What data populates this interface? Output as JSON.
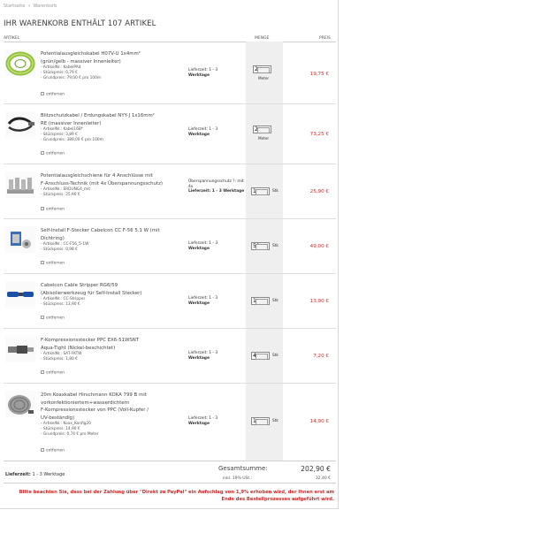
{
  "breadcrumb": {
    "home": "Startseite",
    "separator": "»",
    "current": "Warenkorb"
  },
  "page_title": "IHR WARENKORB ENTHÄLT 107 ARTIKEL",
  "columns": {
    "article": "ARTIKEL",
    "quantity": "MENGE",
    "price": "PREIS"
  },
  "remove_label": "entfernen",
  "items": [
    {
      "name_lines": [
        "Potentialausgleichskabel H07V-U 1x4mm²",
        "(grün/gelb - massiver Innenleiter)"
      ],
      "meta": [
        "- ArtikelNr.: KabelPA4",
        "- Stückpreis: 0,79 €",
        "- Grundpreis: 79,00 € pro 100m"
      ],
      "delivery_label": "Lieferzeit: 1 - 3",
      "delivery_sub": "Werktage",
      "qty": "2",
      "unit": "Meter",
      "price": "19,75 €",
      "thumb": "green-cable-coil"
    },
    {
      "name_lines": [
        "Blitzschutzkabel / Erdungskabel NYY-J 1x16mm²",
        "RE (massiver Innenleiter)"
      ],
      "meta": [
        "- ArtikelNr.: Kabel16B*",
        "- Stückpreis: 3,89 €",
        "- Grundpreis: 389,00 € pro 100m"
      ],
      "delivery_label": "Lieferzeit: 1 - 3",
      "delivery_sub": "Werktage",
      "qty": "2",
      "unit": "Meter",
      "price": "73,25 €",
      "thumb": "black-cable"
    },
    {
      "name_lines": [
        "Potentialausgleichschiene für 4 Anschlüsse mit",
        "F-Anschluss-Technik (mit 4x Überspannungsschutz)"
      ],
      "meta": [
        "- ArtikelNr.: ERDUNG4_mit",
        "- Stückpreis: 25,90 €"
      ],
      "delivery_label": "Überspannungsschutz ?: mit 4x",
      "delivery_sub": "Lieferzeit: 1 - 3 Werktage",
      "qty": "1",
      "unit": "Stk",
      "price": "25,90 €",
      "thumb": "grounding-bar"
    },
    {
      "name_lines": [
        "Self-Install F-Stecker Cabelcon CC F-56 5.1 W (mit",
        "Dichtring)"
      ],
      "meta": [
        "- ArtikelNr.: CC-F56_5-1W",
        "- Stückpreis: 0,98 €"
      ],
      "delivery_label": "Lieferzeit: 1 - 3",
      "delivery_sub": "Werktage",
      "qty": "50",
      "unit": "Stk",
      "price": "49,00 €",
      "thumb": "f-connector"
    },
    {
      "name_lines": [
        "Cabelcon Cable Stripper RG6/59",
        "(Abisolierwerkzeug für Self-Install Stecker)"
      ],
      "meta": [
        "- ArtikelNr.: CC-Stripper",
        "- Stückpreis: 13,90 €"
      ],
      "delivery_label": "Lieferzeit: 1 - 3",
      "delivery_sub": "Werktage",
      "qty": "1",
      "unit": "Stk",
      "price": "13,90 €",
      "thumb": "cable-stripper"
    },
    {
      "name_lines": [
        "F-Kompressionsstecker PPC EX6-51WSNT",
        "Aqua-Tight (Nickel-beschichtet)"
      ],
      "meta": [
        "- ArtikelNr.: SAT-FKTW",
        "- Stückpreis: 1,80 €"
      ],
      "delivery_label": "Lieferzeit: 1 - 3",
      "delivery_sub": "Werktage",
      "qty": "4",
      "unit": "Stk",
      "price": "7,20 €",
      "thumb": "compression-connector"
    },
    {
      "name_lines": [
        "20m Koaxkabel Hirschmann KOKA 799 B mit",
        "vorkonfektioniertem+wasserdichtem",
        "F-Kompressionsstecker von PPC (Voll-Kupfer /",
        "UV-beständig)"
      ],
      "meta": [
        "- ArtikelNr.: Koax_Konfig20",
        "- Stückpreis: 14,90 €",
        "- Grundpreis: 0,74 € pro Meter"
      ],
      "delivery_label": "Lieferzeit: 1 - 3",
      "delivery_sub": "Werktage",
      "qty": "1",
      "unit": "Stk",
      "price": "14,90 €",
      "thumb": "coax-cable-coil"
    }
  ],
  "summary": {
    "delivery_label": "Lieferzeit:",
    "delivery_value": "1 - 3 Werktage",
    "total_label": "Gesamtsumme:",
    "total_value": "202,90 €",
    "vat_label": "inkl. 19% USt.:",
    "vat_value": "32,40 €"
  },
  "notice": "Bitte beachten Sie, dass bei der Zahlung über \"Direkt zu PayPal\" ein Aufschlag von 1,9% erhoben wird, der Ihnen erst am Ende des Bestellprozesses aufgeführt wird.",
  "colors": {
    "price": "#cc2a2a",
    "quantity_column_bg": "#efefef",
    "border": "#dedede"
  }
}
